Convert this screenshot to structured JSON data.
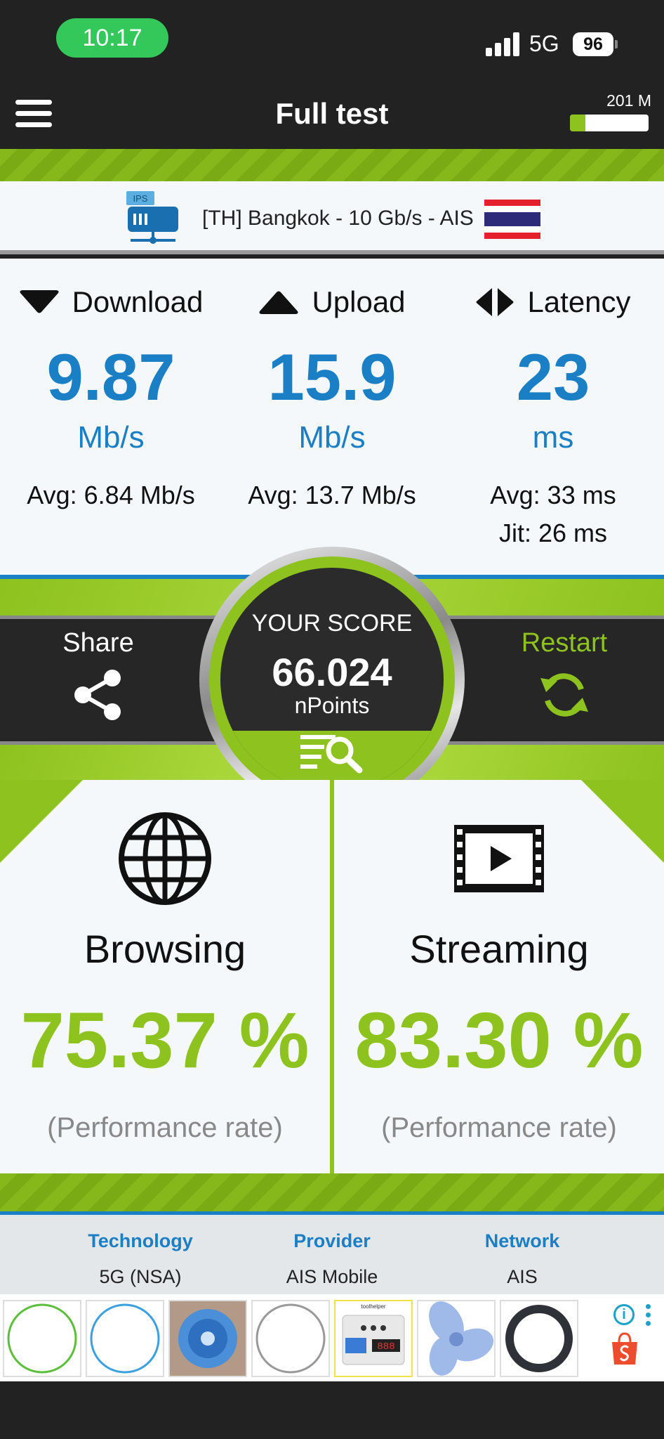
{
  "status_bar": {
    "time": "10:17",
    "network": "5G",
    "battery": "96"
  },
  "header": {
    "title": "Full test",
    "data_usage_label": "201 M",
    "data_usage_fraction": 0.2
  },
  "server": {
    "icon_label": "IPS",
    "label": "[TH] Bangkok - 10 Gb/s - AIS"
  },
  "results": {
    "download": {
      "label": "Download",
      "value": "9.87",
      "unit": "Mb/s",
      "avg": "Avg: 6.84 Mb/s"
    },
    "upload": {
      "label": "Upload",
      "value": "15.9",
      "unit": "Mb/s",
      "avg": "Avg: 13.7 Mb/s"
    },
    "latency": {
      "label": "Latency",
      "value": "23",
      "unit": "ms",
      "avg": "Avg: 33 ms",
      "jitter": "Jit: 26 ms"
    }
  },
  "score": {
    "title": "YOUR SCORE",
    "value": "66.024",
    "unit": "nPoints",
    "share_label": "Share",
    "restart_label": "Restart"
  },
  "performance": {
    "browsing": {
      "title": "Browsing",
      "value": "75.37 %",
      "caption": "(Performance rate)"
    },
    "streaming": {
      "title": "Streaming",
      "value": "83.30 %",
      "caption": "(Performance rate)"
    }
  },
  "info": {
    "technology": {
      "label": "Technology",
      "value": "5G (NSA)"
    },
    "provider": {
      "label": "Provider",
      "value": "AIS Mobile"
    },
    "network": {
      "label": "Network",
      "value": "AIS"
    }
  },
  "ad": {
    "info_icon": "i",
    "products": [
      "green-hoop",
      "blue-hoop",
      "blue-pump-part",
      "grey-hoop",
      "timer-relay-module",
      "fan-blade",
      "rubber-seal-ring"
    ],
    "product_5_brand": "toolhelper",
    "product_5_display": "888"
  },
  "colors": {
    "accent_green": "#8dc21f",
    "accent_blue": "#1a7fc4",
    "dark": "#222222",
    "time_pill": "#34c759"
  }
}
